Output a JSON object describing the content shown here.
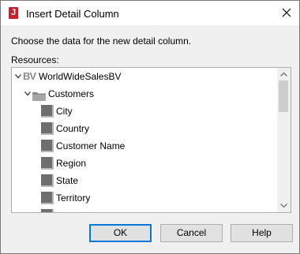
{
  "window": {
    "title": "Insert Detail Column",
    "app_icon_glyph": "J"
  },
  "prompt": "Choose the data for the new detail column.",
  "resources_label": "Resources:",
  "tree": {
    "root": {
      "badge": "BV",
      "label": "WorldWideSalesBV",
      "expanded": true
    },
    "folder": {
      "label": "Customers",
      "expanded": true
    },
    "fields": [
      "City",
      "Country",
      "Customer Name",
      "Region",
      "State",
      "Territory"
    ]
  },
  "buttons": {
    "ok": "OK",
    "cancel": "Cancel",
    "help": "Help"
  },
  "colors": {
    "app_icon": "#c8202f",
    "default_button_border": "#0078d7",
    "field_icon": "#6e6e6e"
  }
}
